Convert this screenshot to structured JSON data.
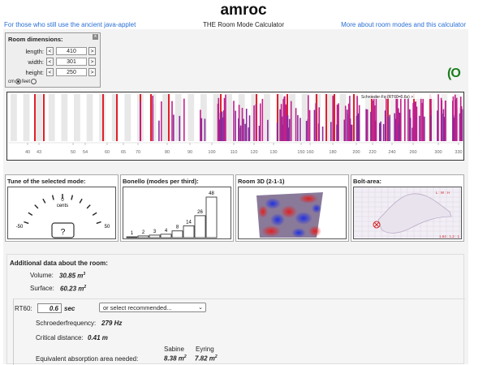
{
  "header": {
    "title": "amroc",
    "subtitle": "THE Room Mode Calculator",
    "link_left": "For those who still use the ancient java-applet",
    "link_right": "More about room modes and this calculator"
  },
  "room_dimensions": {
    "title": "Room dimensions:",
    "close": "x",
    "rows": [
      {
        "label": "length:",
        "value": "410"
      },
      {
        "label": "width:",
        "value": "301"
      },
      {
        "label": "height:",
        "value": "250"
      }
    ],
    "dec_label": "<",
    "inc_label": ">",
    "unit_cm": "cm",
    "unit_feet": "feet"
  },
  "loader_text": "(O",
  "spectrum": {
    "schroeder_label": "Schroeder-Fq (RT60=0.6s) >",
    "ticks": [
      "40",
      "43",
      "50",
      "54",
      "60",
      "65",
      "70",
      "80",
      "90",
      "100",
      "110",
      "120",
      "130",
      "150",
      "160",
      "180",
      "200",
      "220",
      "240",
      "260",
      "300",
      "330"
    ]
  },
  "panels": {
    "tune": {
      "title": "Tune of the selected mode:",
      "zero": "0",
      "unit": "cents",
      "left": "-50",
      "right": "50",
      "readout": "?"
    },
    "bonello": {
      "title": "Bonello (modes per third):",
      "values": [
        1,
        2,
        3,
        4,
        8,
        14,
        26,
        48
      ]
    },
    "room3d": {
      "title": "Room 3D (2-1-1)"
    },
    "bolt": {
      "title": "Bolt-area:",
      "corner": "L : W : H",
      "ratio": "1.64 : 1.2 : 1"
    }
  },
  "additional": {
    "title": "Additional data about the room:",
    "volume_label": "Volume:",
    "volume_value": "30.85 m",
    "surface_label": "Surface:",
    "surface_value": "60.23 m",
    "rt60_label": "RT60:",
    "rt60_value": "0.6",
    "rt60_unit": "sec",
    "rt60_select": "or select recommended...",
    "schroeder_label": "Schroederfrequency:",
    "schroeder_value": "279 Hz",
    "critical_label": "Critical distance:",
    "critical_value": "0.41 m",
    "col_sabine": "Sabine",
    "col_eyring": "Eyring",
    "absorption_label": "Equivalent absorption area needed:",
    "sabine_value": "8.38 m",
    "eyring_value": "7.82 m",
    "sup2": "2",
    "sup3": "3"
  },
  "colors": {
    "axial": "#e0202a",
    "tangential": "#c0208a",
    "oblique": "#8a2a9a",
    "link": "#2a6fd6"
  }
}
